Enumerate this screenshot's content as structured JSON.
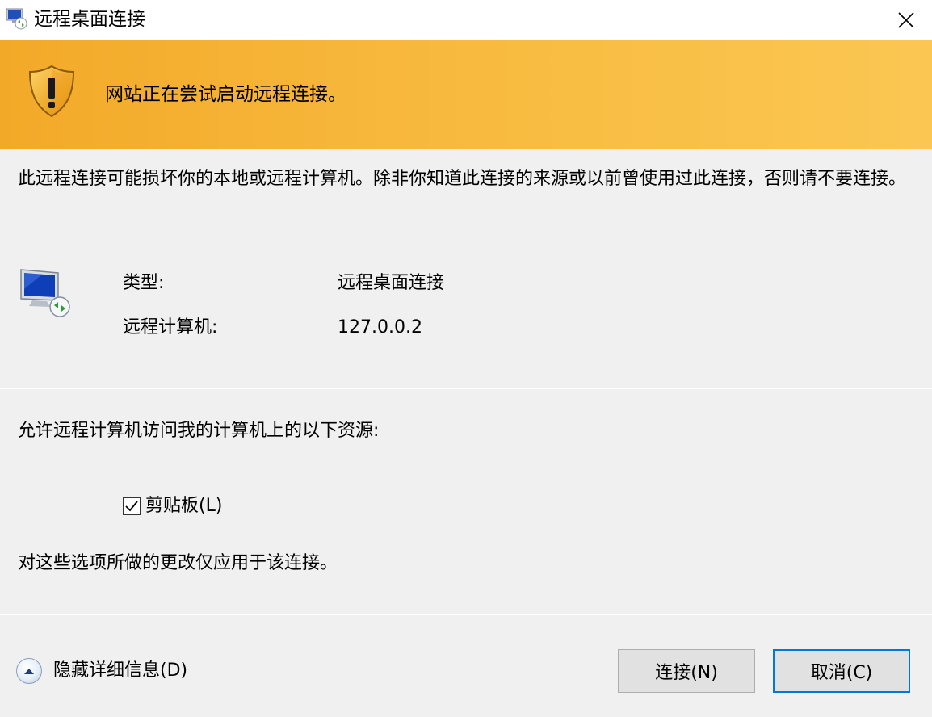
{
  "window": {
    "title": "远程桌面连接",
    "close_icon": "close-icon",
    "app_icon": "remote-desktop-icon"
  },
  "banner": {
    "icon": "warning-shield-icon",
    "text": "网站正在尝试启动远程连接。",
    "colors": {
      "start": "#f3a928",
      "end": "#fbc752"
    }
  },
  "warning": {
    "text": "此远程连接可能损坏你的本地或远程计算机。除非你知道此连接的来源或以前曾使用过此连接，否则请不要连接。"
  },
  "info": {
    "icon": "remote-computer-icon",
    "rows": [
      {
        "label": "类型:",
        "value": "远程桌面连接"
      },
      {
        "label": "远程计算机:",
        "value": "127.0.0.2"
      }
    ]
  },
  "resources": {
    "heading": "允许远程计算机访问我的计算机上的以下资源:",
    "clipboard": {
      "label": "剪贴板(L)",
      "checked": true
    },
    "note": "对这些选项所做的更改仅应用于该连接。"
  },
  "footer": {
    "details_toggle": "隐藏详细信息(D)",
    "connect_button": "连接(N)",
    "cancel_button": "取消(C)",
    "focus_color": "#0078d7"
  }
}
